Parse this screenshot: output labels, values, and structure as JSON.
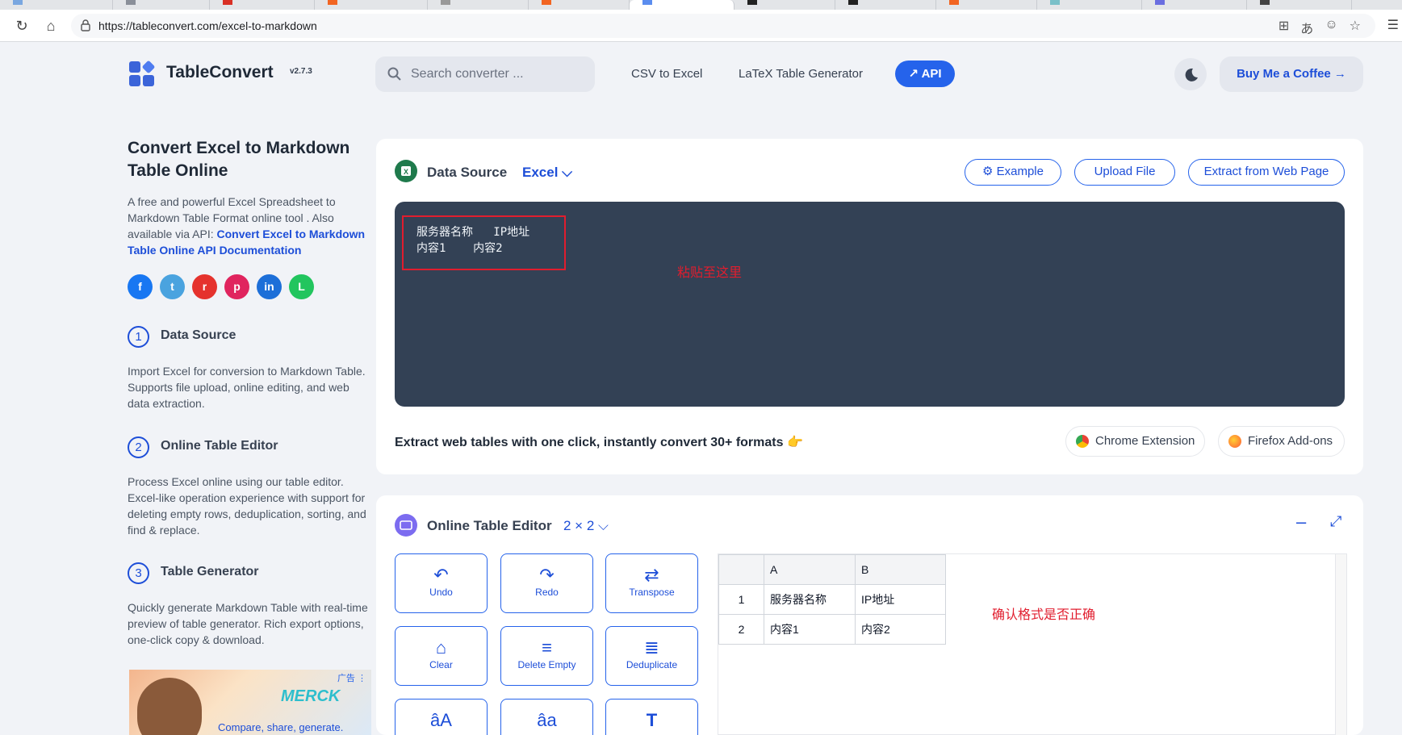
{
  "browser": {
    "url": "https://tableconvert.com/excel-to-markdown"
  },
  "header": {
    "logo_text": "TableConvert",
    "version": "v2.7.3",
    "search_placeholder": "Search converter ...",
    "nav": [
      "CSV to Excel",
      "LaTeX Table Generator"
    ],
    "api_label": "API",
    "coffee_label": "Buy Me a Coffee →"
  },
  "left": {
    "title": "Convert Excel to Markdown Table Online",
    "intro": "A free and powerful Excel Spreadsheet to Markdown Table Format online tool . Also available via API: ",
    "api_link": "Convert Excel to Markdown Table Online API Documentation",
    "social": [
      "f",
      "t",
      "r",
      "p",
      "in",
      "L"
    ],
    "steps": [
      {
        "num": "1",
        "title": "Data Source",
        "desc": "Import Excel for conversion to Markdown Table. Supports file upload, online editing, and web data extraction."
      },
      {
        "num": "2",
        "title": "Online Table Editor",
        "desc": "Process Excel online using our table editor. Excel-like operation experience with support for deleting empty rows, deduplication, sorting, and find & replace."
      },
      {
        "num": "3",
        "title": "Table Generator",
        "desc": "Quickly generate Markdown Table with real-time preview of table generator. Rich export options, one-click copy & download."
      }
    ],
    "ad": {
      "label": "广告 ⋮",
      "brand": "MERCK",
      "tagline": "Compare, share, generate."
    }
  },
  "datasource": {
    "title": "Data Source",
    "format": "Excel",
    "buttons": [
      "Example",
      "Upload File",
      "Extract from Web Page"
    ],
    "code_line1": "服务器名称   IP地址",
    "code_line2": "内容1    内容2",
    "annotation": "粘贴至这里",
    "extract_text": "Extract web tables with one click, instantly convert 30+ formats 👉",
    "chrome_ext": "Chrome Extension",
    "firefox_ext": "Firefox Add-ons"
  },
  "editor": {
    "title": "Online Table Editor",
    "size": "2 × 2",
    "buttons": [
      {
        "label": "Undo",
        "glyph": "↶"
      },
      {
        "label": "Redo",
        "glyph": "↷"
      },
      {
        "label": "Transpose",
        "glyph": "⇄"
      },
      {
        "label": "Clear",
        "glyph": "⌂"
      },
      {
        "label": "Delete Empty",
        "glyph": "≡"
      },
      {
        "label": "Deduplicate",
        "glyph": "≣"
      },
      {
        "label": "",
        "glyph": "âA"
      },
      {
        "label": "",
        "glyph": "âa"
      },
      {
        "label": "",
        "glyph": "T"
      }
    ],
    "grid": {
      "col_headers": [
        "A",
        "B"
      ],
      "rows": [
        {
          "num": "1",
          "cells": [
            "服务器名称",
            "IP地址"
          ]
        },
        {
          "num": "2",
          "cells": [
            "内容1",
            "内容2"
          ]
        }
      ]
    },
    "annotation": "确认格式是否正确"
  },
  "colors": {
    "accent": "#2563eb",
    "annotation_red": "#e11d2e",
    "editor_bg": "#334155"
  }
}
